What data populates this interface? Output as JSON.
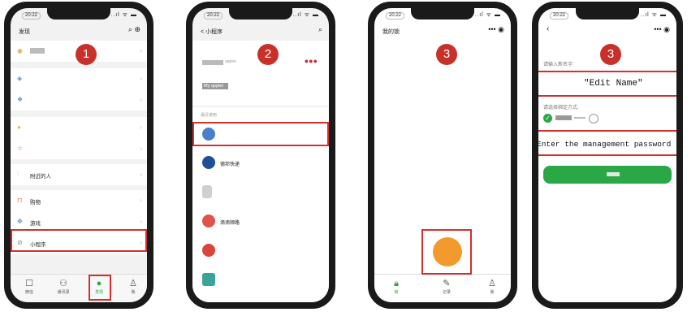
{
  "status": {
    "time": "20:22",
    "signal": "..ıl ᯤ ▬"
  },
  "phone1": {
    "badge": "1",
    "title": "发现",
    "items": [
      {
        "label": "",
        "icon": "moments-icon"
      },
      {
        "label": "",
        "icon": "scan-icon"
      },
      {
        "label": "",
        "icon": "shake-icon"
      },
      {
        "label": "",
        "icon": "search-icon"
      },
      {
        "label": "",
        "icon": "star-icon"
      },
      {
        "label": "附近的人",
        "icon": "nearby-icon"
      },
      {
        "label": "购物",
        "icon": "shop-icon"
      },
      {
        "label": "游戏",
        "icon": "game-icon"
      },
      {
        "label": "小程序",
        "icon": "mini-program-icon"
      }
    ],
    "tabs": [
      "微信",
      "通讯录",
      "发现",
      "我"
    ]
  },
  "phone2": {
    "badge": "2",
    "back": "< 小程序",
    "applet": "My applet",
    "applet_top": "applet",
    "recent": "最近使用",
    "apps": [
      {
        "label": ""
      },
      {
        "label": "德邦快递"
      },
      {
        "label": ""
      },
      {
        "label": "滴滴顺路"
      },
      {
        "label": ""
      },
      {
        "label": ""
      }
    ]
  },
  "phone3": {
    "badge": "3",
    "title": "我的锁",
    "tabs": [
      "锁",
      "记录",
      "我"
    ]
  },
  "phone4": {
    "badge": "3",
    "name_label": "请输入新名字:",
    "name_value": "\"Edit Name\"",
    "bind_label": "请选择绑定方式:",
    "password_placeholder": "Enter the management password"
  },
  "colors": {
    "highlight": "#d32f2f",
    "badge": "#c8312a",
    "green": "#2aa845",
    "orange": "#f29a2e"
  }
}
